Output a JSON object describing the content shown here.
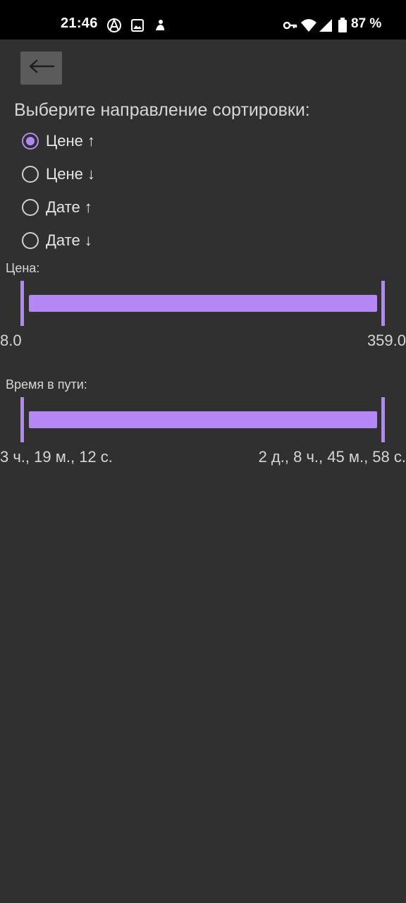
{
  "status_bar": {
    "time": "21:46",
    "left_icons": [
      "anarchy-icon",
      "image-icon",
      "app-icon"
    ],
    "right_icons": [
      "vpn-key-icon",
      "wifi-icon",
      "signal-icon",
      "battery-icon"
    ],
    "battery": "87 %"
  },
  "toolbar": {
    "back_icon": "arrow-left-icon"
  },
  "sort": {
    "heading": "Выберите направление сортировки:",
    "options": [
      {
        "label": "Цене",
        "arrow": "↑",
        "checked": true
      },
      {
        "label": "Цене",
        "arrow": "↓",
        "checked": false
      },
      {
        "label": "Дате",
        "arrow": "↑",
        "checked": false
      },
      {
        "label": "Дате",
        "arrow": "↓",
        "checked": false
      }
    ]
  },
  "price_filter": {
    "label": "Цена:",
    "min": "8.0",
    "max": "359.0"
  },
  "duration_filter": {
    "label": "Время в пути:",
    "min": "3 ч., 19 м., 12 с.",
    "max": "2 д., 8 ч., 45 м., 58 с."
  },
  "colors": {
    "accent": "#b388f5",
    "background": "#303030",
    "status_bar": "#000000"
  }
}
